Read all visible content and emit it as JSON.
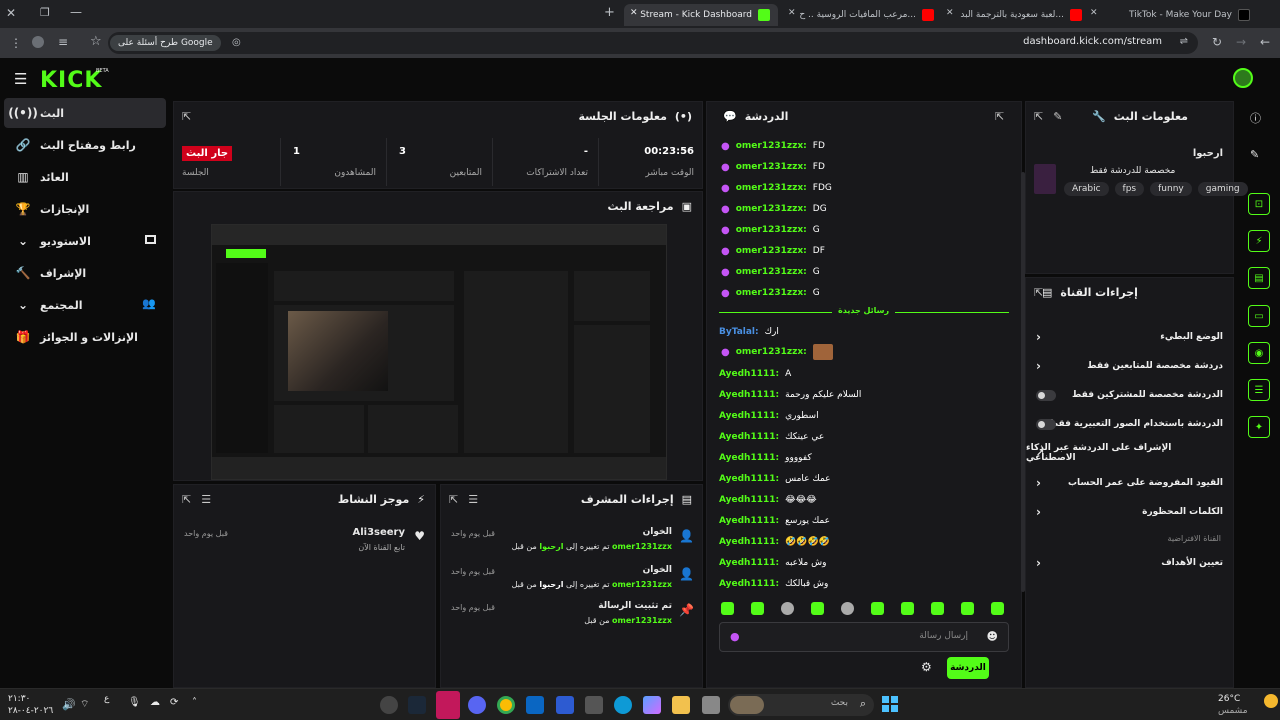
{
  "browser": {
    "tabs": [
      {
        "label": "TikTok - Make Your Day"
      },
      {
        "label": "(194) لعبة سعودية بالترجمة البد..."
      },
      {
        "label": "(194) مرعب المافيات الروسية .. ح..."
      },
      {
        "label": "Stream - Kick Dashboard"
      }
    ],
    "url": "dashboard.kick.com/stream",
    "google_chip": "طرح أسئلة على Google"
  },
  "kick": {
    "logo": "KICK",
    "beta": "BETA"
  },
  "sidebar": {
    "items": [
      {
        "label": "البث"
      },
      {
        "label": "رابط ومفتاح البث"
      },
      {
        "label": "العائد"
      },
      {
        "label": "الإنجازات"
      },
      {
        "label": "الاستوديو"
      },
      {
        "label": "الإشراف"
      },
      {
        "label": "المجتمع"
      },
      {
        "label": "الإنزالات و الجوائز"
      }
    ]
  },
  "session": {
    "title": "معلومات الجلسة",
    "stats": [
      {
        "value": "00:23:56",
        "label": "الوقت مباشر"
      },
      {
        "value": "-",
        "label": "تعداد الاشتراكات"
      },
      {
        "value": "3",
        "label": "المتابعين"
      },
      {
        "value": "1",
        "label": "المشاهدون"
      },
      {
        "value": "جار البث",
        "label": "الجلسة"
      }
    ]
  },
  "preview": {
    "title": "مراجعة البث"
  },
  "activity": {
    "title": "موجز النشاط",
    "item": {
      "user": "Ali3seery",
      "desc": "تابع القناة الآن",
      "time": "قبل يوم واحد"
    }
  },
  "modactions": {
    "title": "إجراءات المشرف",
    "items": [
      {
        "title": "الخوان",
        "pre": "تم تغييره إلى",
        "target": "ارحبوا",
        "mid": "من قبل",
        "user": "omer1231zzx",
        "time": "قبل يوم واحد"
      },
      {
        "title": "الخوان",
        "pre": "تم تغييره إلى",
        "target": "ارحبوا",
        "mid": "من قبل",
        "user": "omer1231zzx",
        "time": "قبل يوم واحد"
      },
      {
        "title": "تم تثبيت الرسالة",
        "pre": "من قبل",
        "user": "omer1231zzx",
        "time": "قبل يوم واحد"
      }
    ]
  },
  "chat": {
    "title": "الدردشة",
    "old_messages": [
      {
        "user": "omer1231zzx:",
        "text": "FD"
      },
      {
        "user": "omer1231zzx:",
        "text": "FD"
      },
      {
        "user": "omer1231zzx:",
        "text": "FDG"
      },
      {
        "user": "omer1231zzx:",
        "text": "DG"
      },
      {
        "user": "omer1231zzx:",
        "text": "G"
      },
      {
        "user": "omer1231zzx:",
        "text": "DF"
      },
      {
        "user": "omer1231zzx:",
        "text": "G"
      },
      {
        "user": "omer1231zzx:",
        "text": "G"
      }
    ],
    "new_label": "رسائل جديدة",
    "reply": {
      "user": "ByTalal:",
      "text": "ارك"
    },
    "messages": [
      {
        "user": "omer1231zzx:",
        "text": ""
      },
      {
        "user": "Ayedh1111:",
        "text": "A"
      },
      {
        "user": "Ayedh1111:",
        "text": "السلام عليكم ورحمة"
      },
      {
        "user": "Ayedh1111:",
        "text": "اسطوري"
      },
      {
        "user": "Ayedh1111:",
        "text": "عي عينكك"
      },
      {
        "user": "Ayedh1111:",
        "text": "كفوووو"
      },
      {
        "user": "Ayedh1111:",
        "text": "عمك عامس"
      },
      {
        "user": "Ayedh1111:",
        "text": "😂😂😂"
      },
      {
        "user": "Ayedh1111:",
        "text": "عمك يورسع"
      },
      {
        "user": "Ayedh1111:",
        "text": "🤣🤣🤣🤣"
      },
      {
        "user": "Ayedh1111:",
        "text": "وش ملاعبه"
      },
      {
        "user": "Ayedh1111:",
        "text": "وش قبالكك"
      }
    ],
    "input_placeholder": "إرسال رسالة",
    "send_label": "الدردشة"
  },
  "streaminfo": {
    "title": "معلومات البث",
    "stream_title": "ارحبوا",
    "category": "مخصصة للدردشة فقط",
    "tags": [
      "Arabic",
      "fps",
      "funny",
      "gaming"
    ]
  },
  "channelactions": {
    "title": "إجراءات القناة",
    "items": [
      {
        "label": "الوضع البطيء"
      },
      {
        "label": "دردشة مخصصة للمتابعين فقط"
      },
      {
        "label": "الدردشة مخصصة للمشتركين فقط"
      },
      {
        "label": "الدردشة باستخدام الصور التعبيرية فقط"
      },
      {
        "label": "الإشراف على الدردشة عبر الذكاء الاصطناعي"
      },
      {
        "label": "القيود المفروضة على عمر الحساب"
      },
      {
        "label": "الكلمات المحظورة"
      }
    ],
    "default_channel": "القناة الافتراضية",
    "goals": "تعيين الأهداف"
  },
  "taskbar": {
    "search": "بحث",
    "weather": "26°C",
    "weather_desc": "مشمس",
    "time": "٢١:٣٠",
    "date": "٢٠٢٦-٠٤-٢٨",
    "lang": "ع"
  },
  "colors": {
    "accent": "#53fc18",
    "live": "#d0011b",
    "mic": "#c455f5"
  }
}
